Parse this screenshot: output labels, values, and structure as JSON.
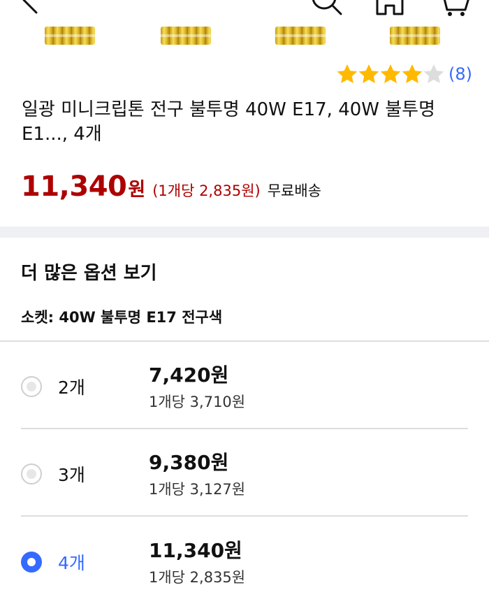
{
  "header": {
    "icons": [
      "back-icon",
      "search-icon",
      "home-icon",
      "cart-icon"
    ]
  },
  "rating": {
    "stars": 4,
    "max_stars": 5,
    "review_count": "(8)",
    "star_color": "#ffb900",
    "empty_star_color": "#dddddd"
  },
  "product": {
    "title": "일광 미니크립톤 전구 불투명 40W E17, 40W 불투명 E1..., 4개",
    "price_number": "11,340",
    "price_unit": "원",
    "unit_price": "(1개당 2,835원)",
    "shipping": "무료배송"
  },
  "options": {
    "heading": "더 많은 옵션 보기",
    "socket_label": "소켓: 40W 불투명 E17 전구색",
    "items": [
      {
        "qty": "2개",
        "price": "7,420원",
        "unit_price": "1개당 3,710원",
        "selected": false
      },
      {
        "qty": "3개",
        "price": "9,380원",
        "unit_price": "1개당 3,127원",
        "selected": false
      },
      {
        "qty": "4개",
        "price": "11,340원",
        "unit_price": "1개당 2,835원",
        "selected": true
      }
    ]
  },
  "colors": {
    "accent": "#346aff",
    "price_red": "#ae0000",
    "divider": "#eef0f3"
  }
}
